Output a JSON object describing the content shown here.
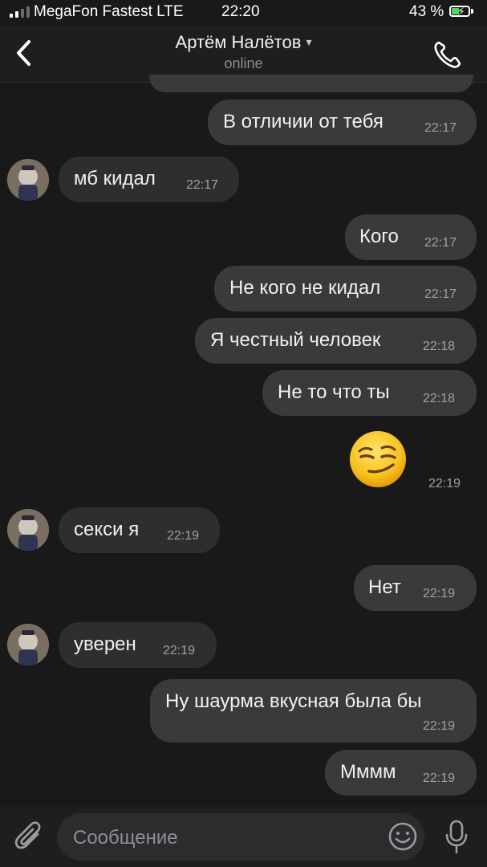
{
  "status_bar": {
    "carrier": "MegaFon Fastest LTE",
    "time": "22:20",
    "battery": "43 %"
  },
  "header": {
    "title": "Артём Налётов",
    "subtitle": "online"
  },
  "messages": [
    {
      "dir": "out",
      "text": "В отличии от тебя",
      "time": "22:17"
    },
    {
      "dir": "in",
      "text": "мб кидал",
      "time": "22:17"
    },
    {
      "dir": "out",
      "text": "Кого",
      "time": "22:17"
    },
    {
      "dir": "out",
      "text": "Не кого не кидал",
      "time": "22:17"
    },
    {
      "dir": "out",
      "text": "Я честный человек",
      "time": "22:18"
    },
    {
      "dir": "out",
      "text": "Не то что ты",
      "time": "22:18"
    },
    {
      "dir": "out",
      "emoji": "smirking-face",
      "time": "22:19"
    },
    {
      "dir": "in",
      "text": "секси я",
      "time": "22:19"
    },
    {
      "dir": "out",
      "text": "Нет",
      "time": "22:19"
    },
    {
      "dir": "in",
      "text": "уверен",
      "time": "22:19"
    },
    {
      "dir": "out",
      "text": "Ну шаурма вкусная была бы",
      "time": "22:19"
    },
    {
      "dir": "out",
      "text": "Мммм",
      "time": "22:19"
    }
  ],
  "input": {
    "placeholder": "Сообщение"
  },
  "colors": {
    "background": "#19191a",
    "bubble_out": "#3a3a3c",
    "bubble_in": "#2e2e30",
    "battery_green": "#4cd964"
  }
}
